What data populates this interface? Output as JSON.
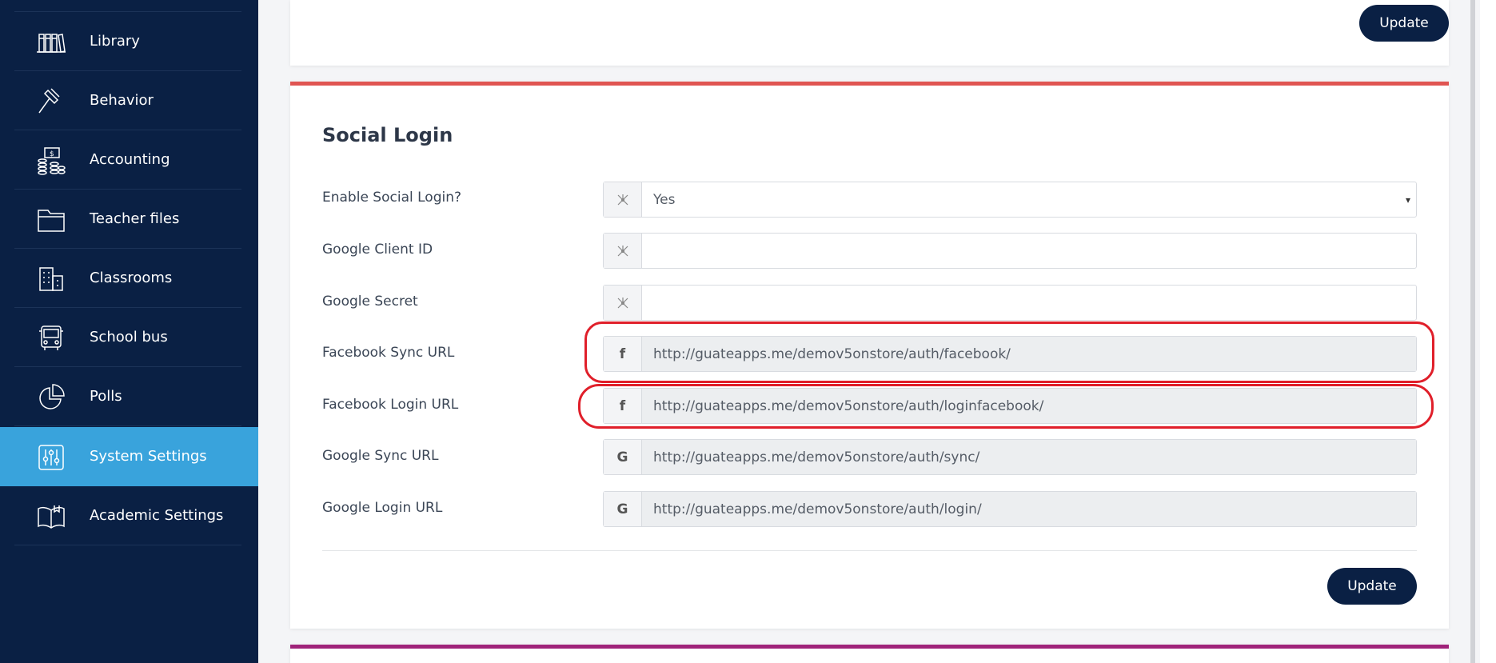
{
  "sidebar": {
    "items": [
      {
        "label": "Library",
        "icon": "library-icon"
      },
      {
        "label": "Behavior",
        "icon": "gavel-icon"
      },
      {
        "label": "Accounting",
        "icon": "money-icon"
      },
      {
        "label": "Teacher files",
        "icon": "folder-icon"
      },
      {
        "label": "Classrooms",
        "icon": "building-icon"
      },
      {
        "label": "School bus",
        "icon": "bus-icon"
      },
      {
        "label": "Polls",
        "icon": "pie-chart-icon"
      },
      {
        "label": "System Settings",
        "icon": "sliders-icon",
        "active": true
      },
      {
        "label": "Academic Settings",
        "icon": "book-icon"
      }
    ]
  },
  "top_card": {
    "update_label": "Update"
  },
  "social_login": {
    "title": "Social Login",
    "enable": {
      "label": "Enable Social Login?",
      "value": "Yes",
      "options": [
        "Yes"
      ]
    },
    "google_client_id": {
      "label": "Google Client ID",
      "value": ""
    },
    "google_secret": {
      "label": "Google Secret",
      "value": ""
    },
    "facebook_sync_url": {
      "label": "Facebook Sync URL",
      "value": "http://guateapps.me/demov5onstore/auth/facebook/",
      "addon": "f"
    },
    "facebook_login_url": {
      "label": "Facebook Login URL",
      "value": "http://guateapps.me/demov5onstore/auth/loginfacebook/",
      "addon": "f"
    },
    "google_sync_url": {
      "label": "Google Sync URL",
      "value": "http://guateapps.me/demov5onstore/auth/sync/",
      "addon": "G"
    },
    "google_login_url": {
      "label": "Google Login URL",
      "value": "http://guateapps.me/demov5onstore/auth/login/",
      "addon": "G"
    },
    "update_label": "Update"
  },
  "colors": {
    "sidebar_bg": "#0a2044",
    "active_item": "#39a3dc",
    "social_accent": "#e05552",
    "next_card_accent": "#a0237a",
    "highlight": "#e01f2a",
    "button_bg": "#0a2044"
  }
}
